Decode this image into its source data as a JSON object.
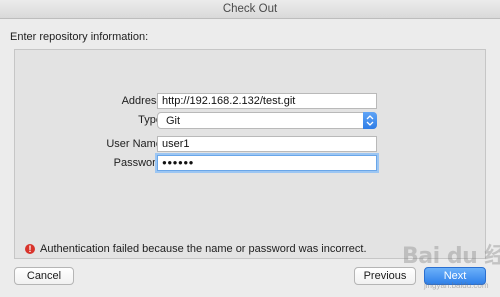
{
  "window": {
    "title": "Check Out"
  },
  "form": {
    "intro": "Enter repository information:",
    "address": {
      "label": "Address:",
      "value": "http://192.168.2.132/test.git"
    },
    "type": {
      "label": "Type:",
      "value": "Git"
    },
    "username": {
      "label": "User Name:",
      "value": "user1"
    },
    "password": {
      "label": "Password:",
      "value": "●●●●●●"
    }
  },
  "error": {
    "icon": "error-icon",
    "message": "Authentication failed because the name or password was incorrect."
  },
  "buttons": {
    "cancel": "Cancel",
    "previous": "Previous",
    "next": "Next"
  },
  "watermark": {
    "text": "Bai du 经验",
    "sub": "jingyan.baidu.com"
  },
  "colors": {
    "accent": "#2f80ea",
    "error": "#d8332b",
    "focus_ring": "#9cc6f3"
  }
}
